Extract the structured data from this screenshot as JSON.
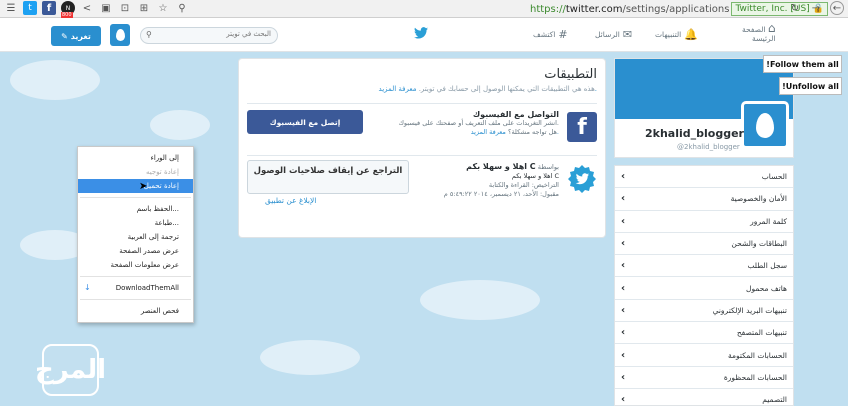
{
  "browser": {
    "url_scheme": "https://",
    "url_host": "twitter.com",
    "url_path": "/settings/applications",
    "ev_badge": "Twitter, Inc. [US]",
    "ext_badge": "800"
  },
  "nav": {
    "tweet_label": "تغريد",
    "search_placeholder": "البحث في تويتر",
    "home_line1": "الصفحة",
    "home_line2": "الرئيسة",
    "notifications": "التنبيهات",
    "messages": "الرسائل",
    "discover": "اكتشف"
  },
  "apps": {
    "title": "التطبيقات",
    "desc": "هذه هي التطبيقات التي يمكنها الوصول إلى حسابك في تويتر.",
    "desc_link": "معرفة المزيد.",
    "fb_name": "التواصل مع الفيسبوك",
    "fb_desc": "انشر التغريدات على ملف التعريف أو صفحتك على فيسبوك.",
    "fb_issue": "هل تواجه مشكلة؟",
    "fb_issue_link": "معرفة المزيد.",
    "fb_button": "إتصل مع الفيسبوك",
    "c_name": "اهلا و سهلا بكم C",
    "c_by": "بواسطة",
    "c_sub": "اهلا و سهلا بكم C",
    "c_perms": "التراخيص: القراءة والكتابة",
    "c_date": "مقبول: الأحد، ٢١ ديسمبر، ٢٠١٤ ٥:٤٩:٢٢ م",
    "revoke_button": "التراجع عن إيقاف صلاحيات الوصول",
    "report_link": "الإبلاغ عن تطبيق"
  },
  "profile": {
    "name": "2khalid_blogger",
    "handle": "@2khalid_blogger",
    "follow_all": "!Follow them all",
    "unfollow_all": "!Unfollow all"
  },
  "settings_nav": [
    "الحساب",
    "الأمان والخصوصية",
    "كلمة المرور",
    "البطاقات والشحن",
    "سجل الطلب",
    "هاتف محمول",
    "تنبيهات البريد الإلكتروني",
    "تنبيهات المتصفح",
    "الحسابات المكتومة",
    "الحسابات المحظورة",
    "التصميم"
  ],
  "context_menu": {
    "back": "إلى الوراء",
    "forward": "إعادة توجيه",
    "reload": "إعادة تحميل",
    "save_as": "الحفظ باسم...",
    "print": "طباعة...",
    "translate": "ترجمة إلى العربية",
    "view_source": "عرض مصدر الصفحة",
    "page_info": "عرض معلومات الصفحة",
    "download_all": "DownloadThemAll",
    "inspect": "فحص العنصر"
  },
  "watermark": "المرج",
  "colors": {
    "twitter_blue": "#2a8fcf",
    "facebook_blue": "#3b5998",
    "menu_highlight": "#3b8fe6"
  }
}
